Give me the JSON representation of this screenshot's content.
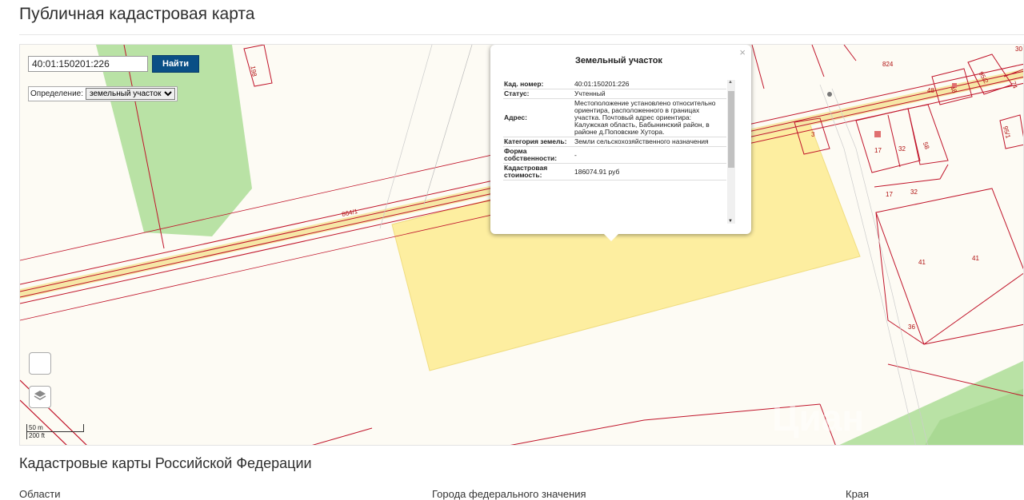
{
  "page": {
    "title": "Публичная кадастровая карта"
  },
  "search": {
    "value": "40:01:150201:226",
    "button_label": "Найти"
  },
  "definition": {
    "label": "Определение:",
    "selected": "земельный участок"
  },
  "popup": {
    "title": "Земельный участок",
    "rows": [
      {
        "key": "Кад. номер:",
        "value": "40:01:150201:226"
      },
      {
        "key": "Статус:",
        "value": "Учтенный"
      },
      {
        "key": "Адрес:",
        "value": "Местоположение установлено относительно ориентира, расположенного в границах участка. Почтовый адрес ориентира: Калужская область, Бабынинский район, в районе д.Поповские Хутора."
      },
      {
        "key": "Категория земель:",
        "value": "Земли сельскохозяйственного назначения"
      },
      {
        "key": "Форма собственности:",
        "value": "-"
      },
      {
        "key": "Кадастровая стоимость:",
        "value": "186074.91 руб"
      }
    ]
  },
  "map": {
    "parcel_labels": [
      "198",
      "864/1",
      "824",
      "3",
      "17",
      "32",
      "58",
      "17",
      "32",
      "48",
      "48",
      "95/2",
      "74",
      "95/1",
      "41",
      "41",
      "36",
      "30"
    ],
    "scale": {
      "metric": "50 m",
      "imperial": "200 ft"
    },
    "watermark": "Циан",
    "colors": {
      "parcel_line": "#c0142a",
      "highlight": "#fdeea0",
      "green": "#b9e2a5",
      "road": "#f6e7a6"
    }
  },
  "footer": {
    "section_title": "Кадастровые карты Российской Федерации",
    "columns": [
      "Области",
      "Города федерального значения",
      "Края"
    ]
  }
}
